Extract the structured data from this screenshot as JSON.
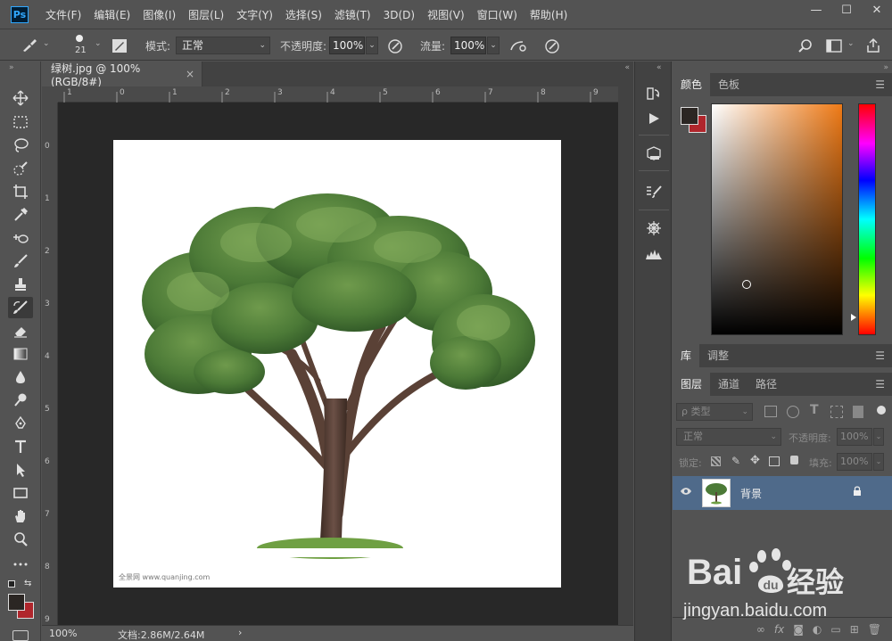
{
  "app": {
    "logo": "Ps"
  },
  "menu": [
    "文件(F)",
    "编辑(E)",
    "图像(I)",
    "图层(L)",
    "文字(Y)",
    "选择(S)",
    "滤镜(T)",
    "3D(D)",
    "视图(V)",
    "窗口(W)",
    "帮助(H)"
  ],
  "window_controls": {
    "minimize": "—",
    "maximize": "☐",
    "close": "✕"
  },
  "options": {
    "brush_size": "21",
    "mode_label": "模式:",
    "mode_value": "正常",
    "opacity_label": "不透明度:",
    "opacity_value": "100%",
    "flow_label": "流量:",
    "flow_value": "100%"
  },
  "document": {
    "tab_title": "绿树.jpg @ 100%(RGB/8#)",
    "tab_close": "×",
    "ruler_top": [
      "1",
      "0",
      "1",
      "2",
      "3",
      "4",
      "5",
      "6",
      "7",
      "8",
      "9"
    ],
    "ruler_left": [
      "0",
      "1",
      "2",
      "3",
      "4",
      "5",
      "6",
      "7",
      "8",
      "9"
    ],
    "watermark": "全景网 www.quanjing.com",
    "zoom": "100%",
    "doc_info": "文档:2.86M/2.64M",
    "status_arrow": "›"
  },
  "panels": {
    "color_tabs": [
      "颜色",
      "色板"
    ],
    "library_tabs": [
      "库",
      "调整"
    ],
    "layers_tabs": [
      "图层",
      "通道",
      "路径"
    ],
    "filter_kind": "ρ 类型",
    "blend_mode": "正常",
    "opacity_label": "不透明度:",
    "opacity_value": "100%",
    "lock_label": "锁定:",
    "fill_label": "填充:",
    "fill_value": "100%",
    "layer_name": "背景",
    "footer_fx": "fx"
  },
  "colors": {
    "foreground": "#2b2623",
    "background": "#b0262c",
    "accent": "#31a8ff",
    "selected_layer": "#4f6a8a"
  },
  "baidu_watermark": {
    "brand": "Bai",
    "brand_cn": "经验",
    "url": "jingyan.baidu.com"
  }
}
